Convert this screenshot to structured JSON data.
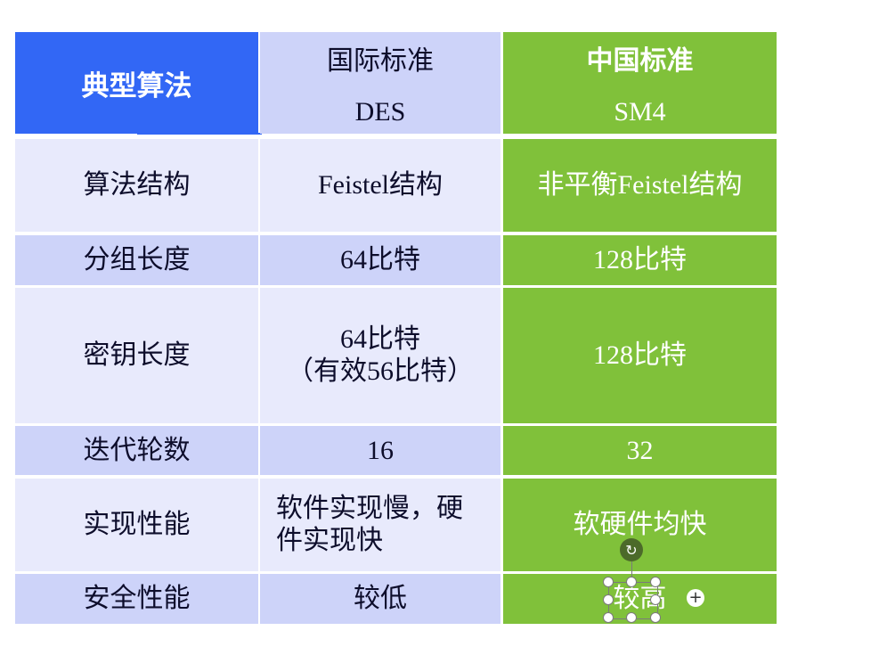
{
  "header": {
    "col0": "典型算法",
    "col1_line1": "国际标准",
    "col1_line2": "DES",
    "col2_line1": "中国标准",
    "col2_line2": "SM4"
  },
  "rows": [
    {
      "label": "算法结构",
      "des": "Feistel结构",
      "sm4": "非平衡Feistel结构"
    },
    {
      "label": "分组长度",
      "des": "64比特",
      "sm4": "128比特"
    },
    {
      "label": "密钥长度",
      "des_line1": "64比特",
      "des_line2": "（有效56比特）",
      "sm4": "128比特"
    },
    {
      "label": "迭代轮数",
      "des": "16",
      "sm4": "32"
    },
    {
      "label": "实现性能",
      "des_line1": "软件实现慢，硬",
      "des_line2": "件实现快",
      "sm4": "软硬件均快"
    },
    {
      "label": "安全性能",
      "des": "较低",
      "sm4": "较高"
    }
  ],
  "icons": {
    "rotate": "rotate-handle-icon",
    "plus": "plus-icon"
  },
  "colors": {
    "header_blue": "#3267f5",
    "lavender": "#cdd3f9",
    "light_lavender": "#e8eafc",
    "green": "#80c13a"
  }
}
